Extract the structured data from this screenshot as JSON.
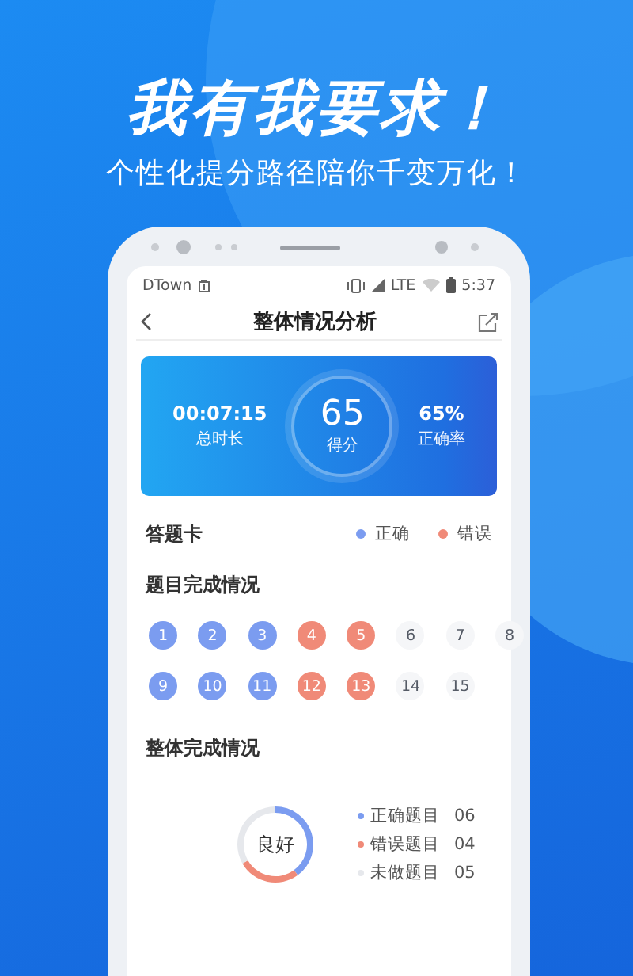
{
  "banner": {
    "headline": "我有我要求！",
    "tagline": "个性化提分路径陪你千变万化！"
  },
  "status_bar": {
    "carrier": "DTown",
    "network": "LTE",
    "time": "5:37"
  },
  "nav": {
    "title": "整体情况分析"
  },
  "score_card": {
    "duration": "00:07:15",
    "duration_label": "总时长",
    "score": "65",
    "score_label": "得分",
    "accuracy": "65%",
    "accuracy_label": "正确率"
  },
  "answer_card": {
    "title": "答题卡",
    "legend": [
      {
        "label": "正确",
        "color": "#7b9cf0"
      },
      {
        "label": "错误",
        "color": "#f08a78"
      }
    ],
    "section_title": "题目完成情况",
    "questions": [
      {
        "number": "1",
        "kind": "correct"
      },
      {
        "number": "2",
        "kind": "correct"
      },
      {
        "number": "3",
        "kind": "correct"
      },
      {
        "number": "4",
        "kind": "wrong"
      },
      {
        "number": "5",
        "kind": "wrong"
      },
      {
        "number": "6",
        "kind": "undone"
      },
      {
        "number": "7",
        "kind": "undone"
      },
      {
        "number": "8",
        "kind": "undone"
      },
      {
        "number": "9",
        "kind": "correct"
      },
      {
        "number": "10",
        "kind": "correct"
      },
      {
        "number": "11",
        "kind": "correct"
      },
      {
        "number": "12",
        "kind": "wrong"
      },
      {
        "number": "13",
        "kind": "wrong"
      },
      {
        "number": "14",
        "kind": "undone"
      },
      {
        "number": "15",
        "kind": "undone"
      }
    ]
  },
  "overview": {
    "title": "整体完成情况",
    "center_label": "良好",
    "legend": [
      {
        "value": "06",
        "color": "#7b9cf0"
      },
      {
        "value": "04",
        "color": "#f08a78"
      },
      {
        "value": "05",
        "color": "#e6e8ec"
      }
    ],
    "chart_data": {
      "type": "donut",
      "categories": [
        "正确题目",
        "错误题目",
        "未做题目"
      ],
      "values": [
        40,
        26.7,
        33.3
      ]
    }
  }
}
